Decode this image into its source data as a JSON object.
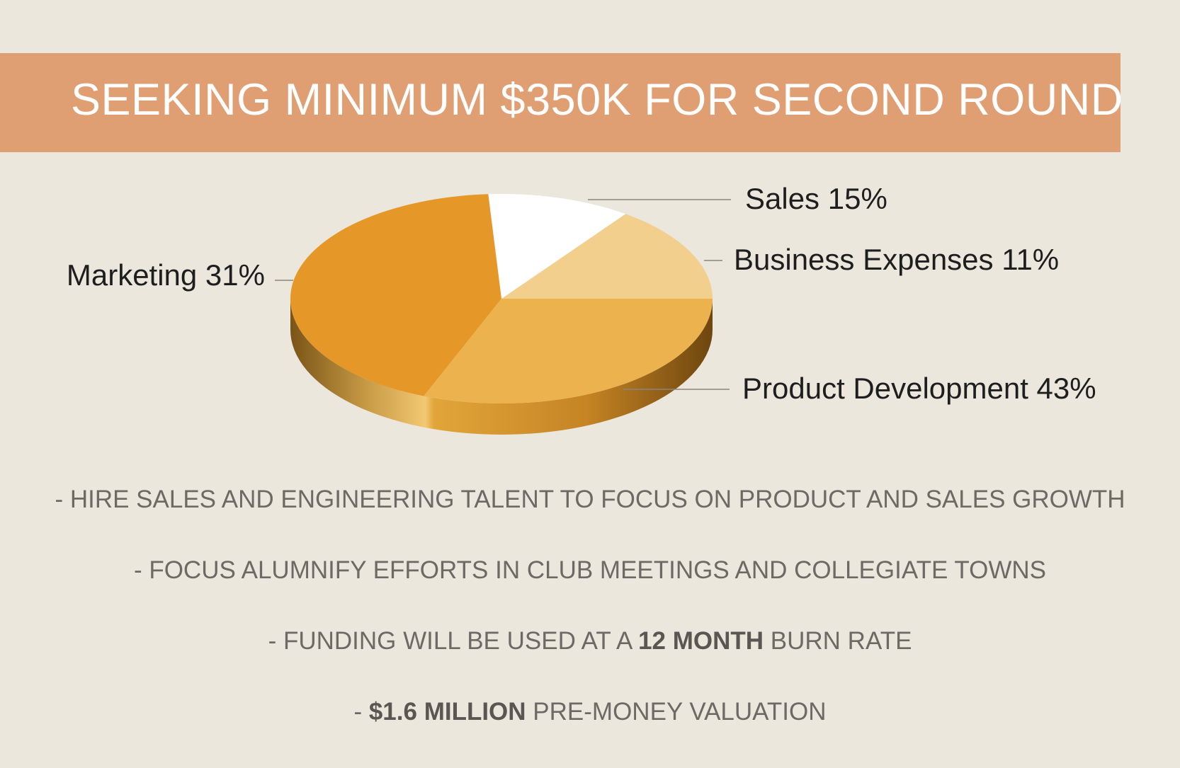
{
  "title": "SEEKING MINIMUM $350K FOR SECOND ROUND",
  "chart_data": {
    "type": "pie",
    "slices": [
      {
        "label": "Sales 15%",
        "name": "Sales",
        "value": 15,
        "color": "#f2cf8d"
      },
      {
        "label": "Business Expenses 11%",
        "name": "Business Expenses",
        "value": 11,
        "color": "#ffffff"
      },
      {
        "label": "Product Development 43%",
        "name": "Product Development",
        "value": 43,
        "color": "#e59727"
      },
      {
        "label": "Marketing 31%",
        "name": "Marketing",
        "value": 31,
        "color": "#ebb24e"
      }
    ]
  },
  "bullets": [
    {
      "text": "- HIRE SALES AND ENGINEERING TALENT TO FOCUS ON PRODUCT AND SALES GROWTH"
    },
    {
      "text": "- FOCUS ALUMNIFY EFFORTS IN CLUB MEETINGS AND COLLEGIATE TOWNS"
    },
    {
      "pre": "- FUNDING WILL BE USED AT A ",
      "bold": "12 MONTH",
      "post": " BURN RATE"
    },
    {
      "pre": "- ",
      "bold": "$1.6 MILLION",
      "post": " PRE-MONEY VALUATION"
    }
  ]
}
